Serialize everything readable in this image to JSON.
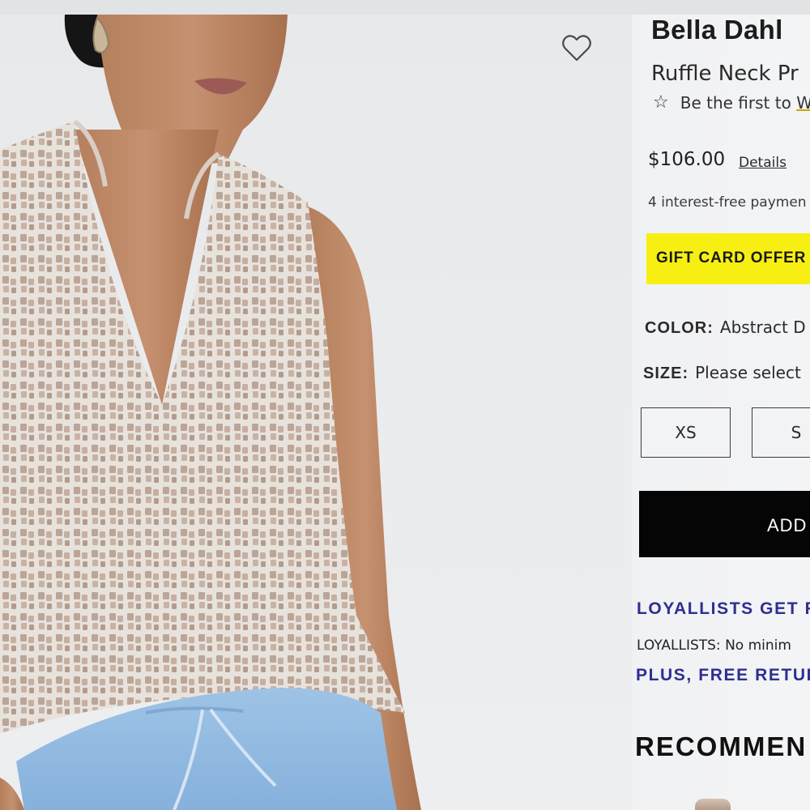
{
  "product": {
    "brand": "Bella Dahl",
    "name": "Ruffle Neck Pr",
    "review_prompt_prefix": "Be the first to",
    "review_prompt_link": "W",
    "price": "$106.00",
    "details_link": "Details",
    "installments": "4 interest-free paymen",
    "gift_banner": "GIFT CARD OFFER",
    "color_label": "COLOR:",
    "color_value": "Abstract D",
    "size_label": "SIZE:",
    "size_value": "Please select",
    "sizes": [
      "XS",
      "S"
    ],
    "add_button": "ADD"
  },
  "loyalty": {
    "heading": "LOYALLISTS GET F",
    "text": "LOYALLISTS: No minim",
    "returns": "PLUS, FREE RETUR"
  },
  "recommendations": {
    "heading": "RECOMMEN"
  },
  "colors": {
    "gift_banner_bg": "#f7ef12",
    "loyalty_blue": "#2e2f8f",
    "button_black": "#050505"
  },
  "icons": {
    "wishlist": "heart-outline-icon",
    "review_star": "star-outline-icon"
  }
}
